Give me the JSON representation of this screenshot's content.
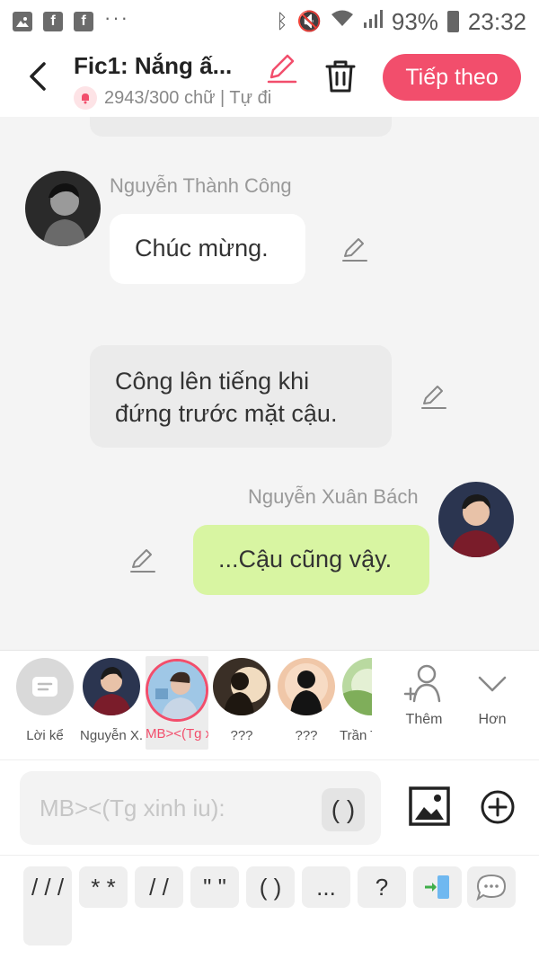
{
  "status_bar": {
    "battery": "93%",
    "time": "23:32",
    "fb1": "f",
    "fb2": "f",
    "more": "···"
  },
  "header": {
    "title": "Fic1: Nắng ấ...",
    "subline": "2943/300 chữ | Tự đi",
    "next_label": "Tiếp theo",
    "accent": "#f24e6c"
  },
  "messages": [
    {
      "sender": "Nguyễn Thành Công",
      "side": "left",
      "text": "Chúc mừng."
    },
    {
      "sender": "",
      "side": "narration",
      "text": "Công lên tiếng khi đứng trước mặt cậu."
    },
    {
      "sender": "Nguyễn Xuân Bách",
      "side": "right",
      "text": "...Cậu cũng vậy."
    }
  ],
  "colors": {
    "bubble_left": "#ffffff",
    "bubble_narration": "#ebebeb",
    "bubble_right": "#d8f5a2"
  },
  "characters": [
    {
      "label": "Lời kể",
      "icon": "narration-icon"
    },
    {
      "label": "Nguyễn X...",
      "icon": "avatar"
    },
    {
      "label": "MB><(Tg x...",
      "icon": "avatar",
      "selected": true
    },
    {
      "label": "???",
      "icon": "silhouette"
    },
    {
      "label": "???",
      "icon": "silhouette"
    },
    {
      "label": "Trần T...",
      "icon": "avatar"
    }
  ],
  "actions": {
    "add_label": "Thêm",
    "more_label": "Hơn"
  },
  "composer": {
    "placeholder": "MB><(Tg xinh iu):",
    "paren": "( )"
  },
  "quick_keys": [
    "/ / /",
    "* *",
    "/ /",
    "\" \"",
    "( )",
    "...",
    "?"
  ],
  "quick_icons": [
    "phone-transfer-icon",
    "chat-bubble-icon"
  ]
}
